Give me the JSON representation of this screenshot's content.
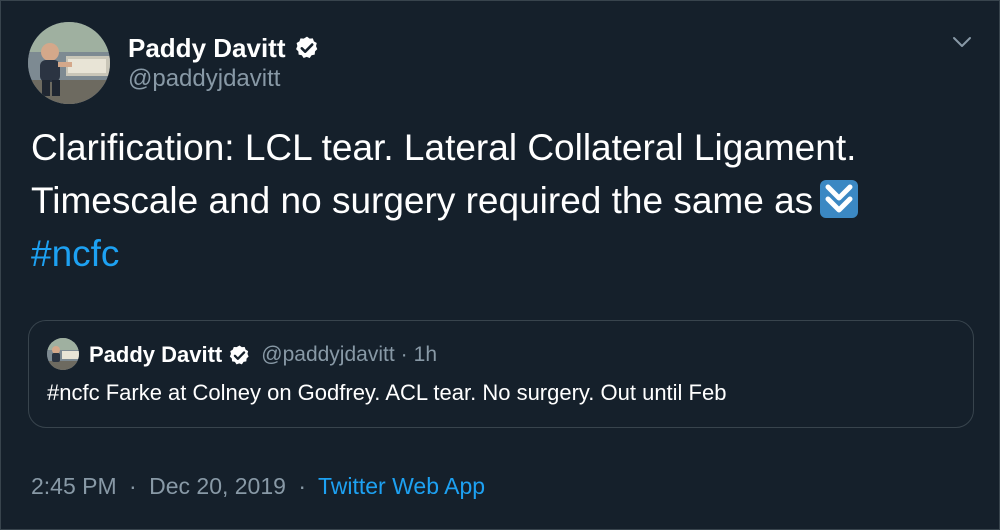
{
  "author": {
    "name": "Paddy Davitt",
    "handle": "@paddyjdavitt",
    "verified": true
  },
  "tweet": {
    "line1": "Clarification: LCL tear. Lateral Collateral Ligament.",
    "line2": "Timescale and no surgery required the same as",
    "emoji": "double-down-arrow-emoji",
    "hashtag": "#ncfc"
  },
  "quoted_tweet": {
    "name": "Paddy Davitt",
    "handle": "@paddyjdavitt",
    "separator": "·",
    "time": "1h",
    "text": "#ncfc Farke at Colney on Godfrey. ACL tear. No surgery. Out until Feb",
    "verified": true
  },
  "meta": {
    "time": "2:45 PM",
    "separator1": "·",
    "date": "Dec 20, 2019",
    "separator2": "·",
    "source": "Twitter Web App"
  },
  "icons": {
    "verified": "verified-badge-icon",
    "caret": "chevron-down-icon"
  },
  "colors": {
    "background": "#15202b",
    "border": "#38444d",
    "accent": "#1da1f2",
    "muted": "#8899a6",
    "emoji_blue": "#3b88c3"
  }
}
